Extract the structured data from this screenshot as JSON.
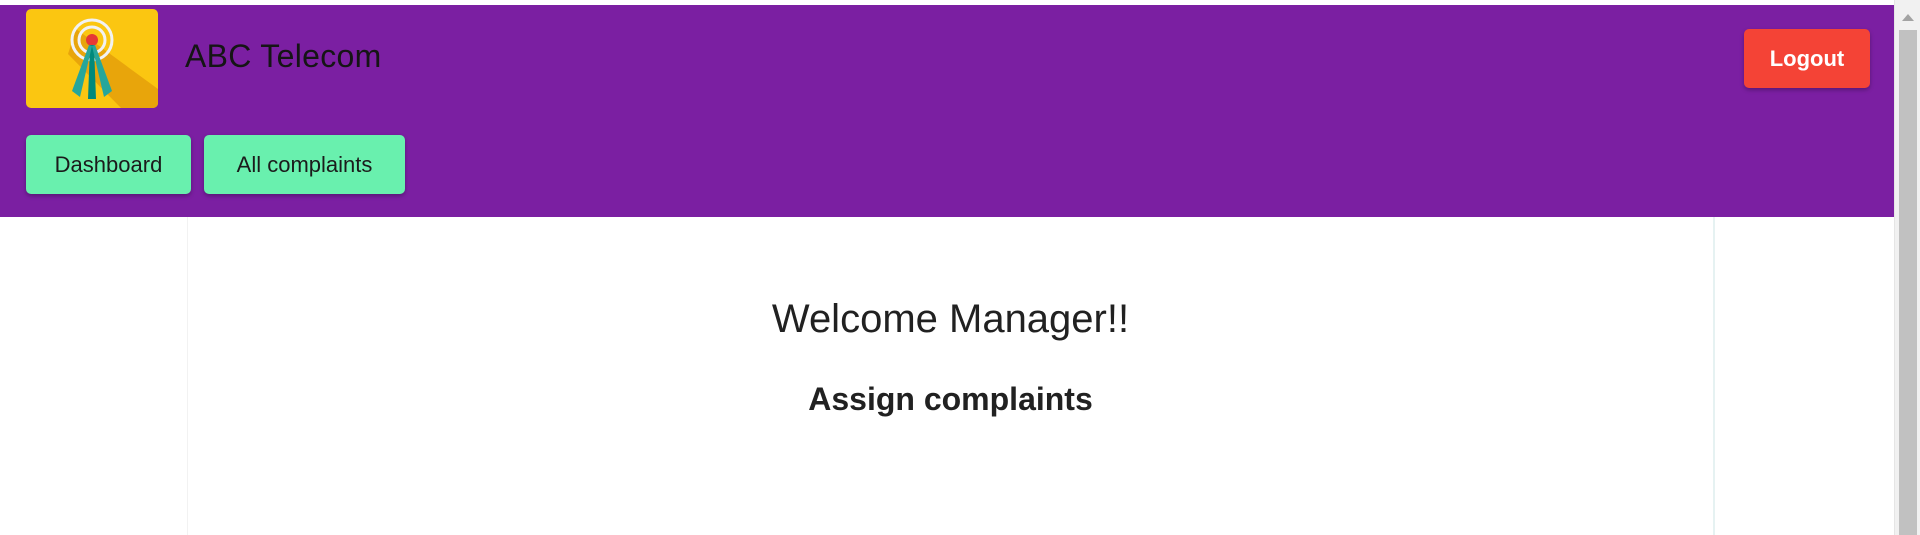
{
  "header": {
    "brand_name": "ABC Telecom",
    "logout_label": "Logout",
    "logo_icon": "antenna-signal-icon"
  },
  "nav": {
    "items": [
      {
        "label": "Dashboard"
      },
      {
        "label": "All complaints"
      }
    ]
  },
  "main": {
    "welcome": "Welcome Manager!!",
    "subheading": "Assign complaints"
  },
  "colors": {
    "header_bg": "#7b1fa2",
    "nav_button": "#69f0ae",
    "logout_button": "#f44336",
    "logo_bg": "#fbc611"
  }
}
